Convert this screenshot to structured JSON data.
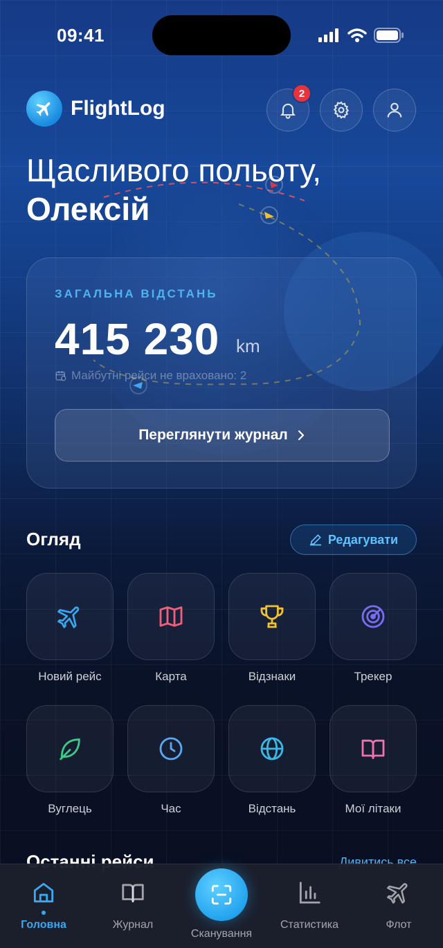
{
  "status_bar": {
    "time": "09:41"
  },
  "header": {
    "app_name": "FlightLog",
    "notification_count": "2"
  },
  "greeting": {
    "line1": "Щасливого польоту,",
    "name": "Олексій"
  },
  "distance_card": {
    "label": "ЗАГАЛЬНА ВІДСТАНЬ",
    "value": "415 230",
    "unit": "km",
    "note": "Майбутні рейси не враховано: 2",
    "cta": "Переглянути журнал"
  },
  "overview": {
    "title": "Огляд",
    "edit_label": "Редагувати",
    "tiles": [
      {
        "label": "Новий рейс",
        "icon": "airplane-icon",
        "color": "#3aa8f0"
      },
      {
        "label": "Карта",
        "icon": "map-icon",
        "color": "#f0607a"
      },
      {
        "label": "Відзнаки",
        "icon": "trophy-icon",
        "color": "#f0c030"
      },
      {
        "label": "Трекер",
        "icon": "radar-icon",
        "color": "#7a6cf0"
      },
      {
        "label": "Вуглець",
        "icon": "leaf-icon",
        "color": "#3ec88a"
      },
      {
        "label": "Час",
        "icon": "clock-icon",
        "color": "#5aa8f0"
      },
      {
        "label": "Відстань",
        "icon": "globe-icon",
        "color": "#3ab8e8"
      },
      {
        "label": "Мої літаки",
        "icon": "book-icon",
        "color": "#f070b0"
      }
    ]
  },
  "recent": {
    "title": "Останні рейси",
    "see_all": "Дивитись все"
  },
  "tabbar": {
    "home": "Головна",
    "journal": "Журнал",
    "scan": "Сканування",
    "stats": "Статистика",
    "fleet": "Флот"
  }
}
